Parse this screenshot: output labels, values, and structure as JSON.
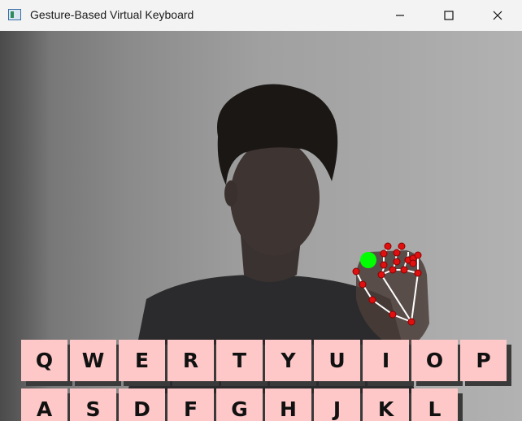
{
  "window": {
    "title": "Gesture-Based Virtual Keyboard",
    "controls": {
      "minimize": "minimize-icon",
      "maximize": "maximize-icon",
      "close": "close-icon"
    }
  },
  "keyboard": {
    "row1": [
      "Q",
      "W",
      "E",
      "R",
      "T",
      "Y",
      "U",
      "I",
      "O",
      "P"
    ],
    "row2": [
      "A",
      "S",
      "D",
      "F",
      "G",
      "H",
      "J",
      "K",
      "L"
    ]
  },
  "colors": {
    "key_fill": "#ffc8c8",
    "key_shadow": "#3a3a3a",
    "landmark": "#e01010",
    "fingertip_cursor": "#00ff00",
    "skeleton": "#ffffff"
  }
}
